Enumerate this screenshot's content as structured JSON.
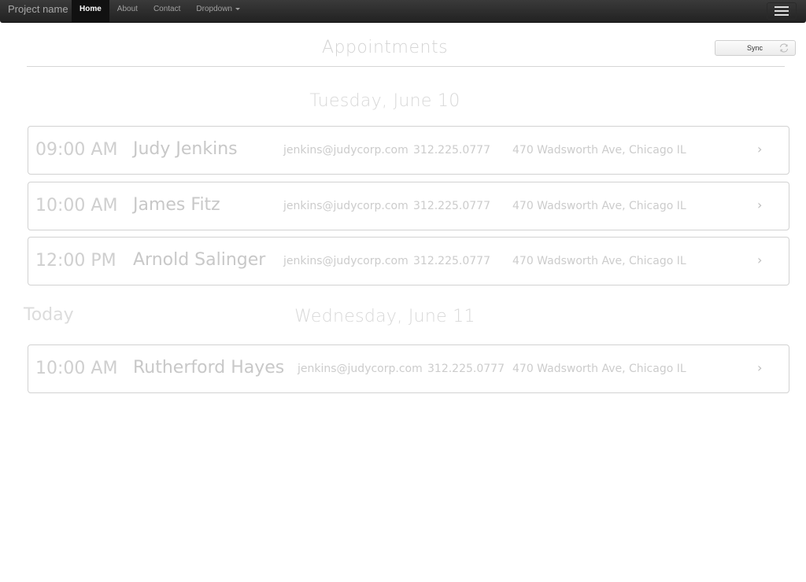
{
  "navbar": {
    "brand": "Project name",
    "items": [
      {
        "label": "Home",
        "active": true
      },
      {
        "label": "About",
        "active": false
      },
      {
        "label": "Contact",
        "active": false
      },
      {
        "label": "Dropdown",
        "active": false
      }
    ],
    "menu_icon": "hamburger-icon"
  },
  "toolbar": {
    "sync_label": "Sync",
    "sync_icon": "refresh-icon"
  },
  "page": {
    "title": "Appointments",
    "today_label": "Today"
  },
  "days": [
    {
      "heading": "Tuesday, June 10",
      "appointments": [
        {
          "time": "09:00 AM",
          "name": "Judy Jenkins",
          "email": "jenkins@judycorp.com",
          "phone": "312.225.0777",
          "address": "470 Wadsworth Ave, Chicago  IL"
        },
        {
          "time": "10:00 AM",
          "name": "James Fitz",
          "email": "jenkins@judycorp.com",
          "phone": "312.225.0777",
          "address": "470 Wadsworth Ave, Chicago  IL"
        },
        {
          "time": "12:00 PM",
          "name": "Arnold Salinger",
          "email": "jenkins@judycorp.com",
          "phone": "312.225.0777",
          "address": "470 Wadsworth Ave, Chicago  IL"
        }
      ]
    },
    {
      "heading": "Wednesday, June 11",
      "appointments": [
        {
          "time": "10:00 AM",
          "name": "Rutherford Hayes",
          "email": "jenkins@judycorp.com",
          "phone": "312.225.0777",
          "address": "470 Wadsworth Ave, Chicago  IL"
        }
      ]
    }
  ],
  "chevron_glyph": "›"
}
